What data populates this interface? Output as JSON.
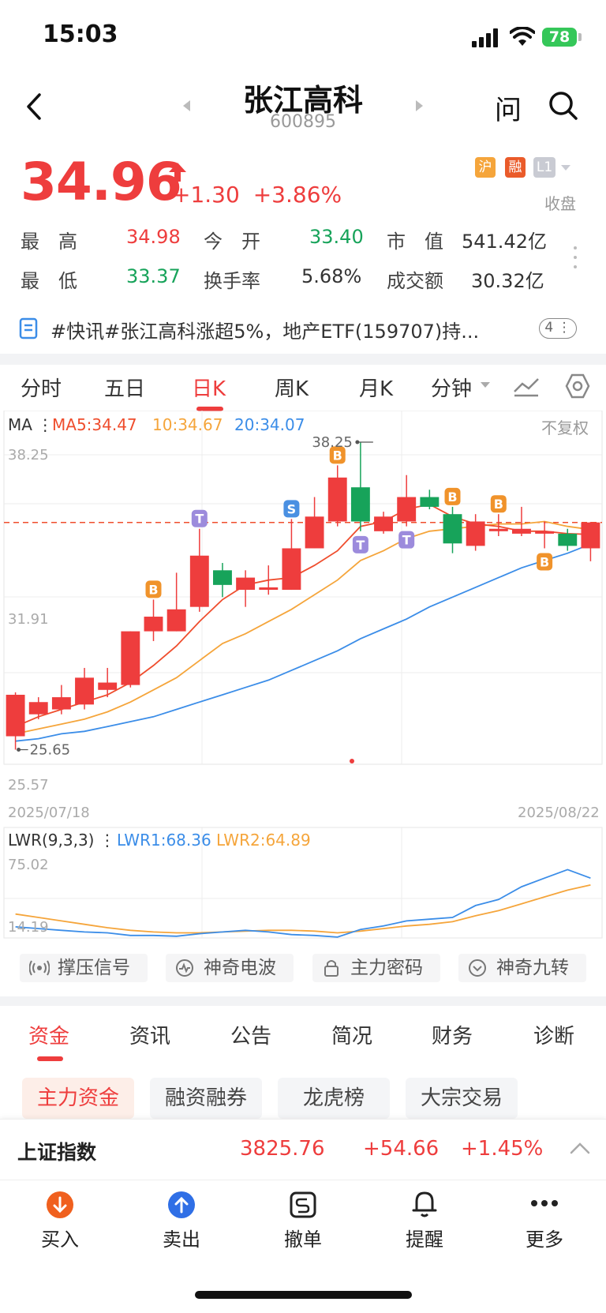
{
  "status_bar": {
    "time": "15:03",
    "battery": "78"
  },
  "header": {
    "name": "张江高科",
    "code": "600895",
    "ask_label": "问"
  },
  "quote": {
    "price": "34.96",
    "change": "+1.30",
    "change_pct": "+3.86%",
    "badges": [
      "沪",
      "融",
      "L1"
    ],
    "market_status": "收盘",
    "stats": [
      {
        "label": "最　高",
        "value": "34.98",
        "color": "red"
      },
      {
        "label": "今　开",
        "value": "33.40",
        "color": "green"
      },
      {
        "label": "市　值",
        "value": "541.42亿",
        "color": "dark"
      },
      {
        "label": "最　低",
        "value": "33.37",
        "color": "green"
      },
      {
        "label": "换手率",
        "value": "5.68%",
        "color": "dark"
      },
      {
        "label": "成交额",
        "value": "30.32亿",
        "color": "dark"
      }
    ]
  },
  "news": {
    "text": "#快讯#张江高科涨超5%，地产ETF(159707)持...",
    "count": "4"
  },
  "chart_tabs": [
    "分时",
    "五日",
    "日K",
    "周K",
    "月K",
    "分钟"
  ],
  "chart_tab_active": "日K",
  "ma_legend": {
    "title": "MA",
    "ma5": "MA5:34.47",
    "ma10": "10:34.67",
    "ma20": "20:34.07",
    "adjust": "不复权"
  },
  "colors": {
    "up": "#ee3d3d",
    "down": "#17a35a",
    "ma5": "#ef4d2d",
    "ma10": "#f5a53b",
    "ma20": "#3b8de8"
  },
  "chart_data": {
    "type": "candlestick",
    "y_axis_labels": [
      "38.25",
      "31.91",
      "25.57"
    ],
    "ylim": [
      25.57,
      38.25
    ],
    "x_start": "2025/07/18",
    "x_end": "2025/08/22",
    "high_marker": "38.25",
    "low_marker": "25.65",
    "current_price_line": 34.96,
    "candles": [
      {
        "o": 26.2,
        "c": 27.9,
        "h": 28.0,
        "l": 25.65
      },
      {
        "o": 27.1,
        "c": 27.6,
        "h": 27.8,
        "l": 26.9
      },
      {
        "o": 27.3,
        "c": 27.8,
        "h": 28.3,
        "l": 27.1
      },
      {
        "o": 27.5,
        "c": 28.6,
        "h": 29.0,
        "l": 27.3
      },
      {
        "o": 28.1,
        "c": 28.4,
        "h": 29.0,
        "l": 27.8
      },
      {
        "o": 28.3,
        "c": 30.5,
        "h": 30.5,
        "l": 28.2
      },
      {
        "o": 30.5,
        "c": 31.1,
        "h": 31.8,
        "l": 30.1
      },
      {
        "o": 30.5,
        "c": 31.4,
        "h": 32.9,
        "l": 30.5
      },
      {
        "o": 31.5,
        "c": 33.6,
        "h": 34.7,
        "l": 31.3
      },
      {
        "o": 33.0,
        "c": 32.4,
        "h": 33.3,
        "l": 31.9
      },
      {
        "o": 32.2,
        "c": 32.7,
        "h": 33.0,
        "l": 31.5
      },
      {
        "o": 32.2,
        "c": 32.3,
        "h": 33.2,
        "l": 32.0
      },
      {
        "o": 32.2,
        "c": 33.9,
        "h": 35.1,
        "l": 32.2
      },
      {
        "o": 33.9,
        "c": 35.2,
        "h": 36.0,
        "l": 33.9
      },
      {
        "o": 35.0,
        "c": 36.8,
        "h": 37.3,
        "l": 34.8
      },
      {
        "o": 36.4,
        "c": 35.0,
        "h": 38.25,
        "l": 34.6
      },
      {
        "o": 34.6,
        "c": 35.2,
        "h": 35.4,
        "l": 34.5
      },
      {
        "o": 35.0,
        "c": 36.0,
        "h": 36.9,
        "l": 34.8
      },
      {
        "o": 36.0,
        "c": 35.6,
        "h": 36.3,
        "l": 35.5
      },
      {
        "o": 35.3,
        "c": 34.1,
        "h": 35.6,
        "l": 33.7
      },
      {
        "o": 34.0,
        "c": 35.0,
        "h": 35.3,
        "l": 33.8
      },
      {
        "o": 34.6,
        "c": 34.7,
        "h": 35.3,
        "l": 34.4
      },
      {
        "o": 34.5,
        "c": 34.7,
        "h": 35.6,
        "l": 34.4
      },
      {
        "o": 34.5,
        "c": 34.6,
        "h": 35.0,
        "l": 33.9
      },
      {
        "o": 34.5,
        "c": 34.0,
        "h": 34.7,
        "l": 33.8
      },
      {
        "o": 33.9,
        "c": 34.96,
        "h": 34.98,
        "l": 33.37
      }
    ],
    "ma5": [
      26.6,
      27.0,
      27.3,
      27.6,
      27.9,
      28.4,
      29.1,
      29.9,
      30.9,
      31.8,
      32.4,
      32.6,
      32.7,
      33.2,
      33.8,
      34.8,
      35.0,
      35.5,
      35.7,
      35.2,
      34.9,
      34.8,
      34.6,
      34.6,
      34.5,
      34.47
    ],
    "ma10": [
      26.3,
      26.5,
      26.7,
      26.9,
      27.2,
      27.6,
      28.1,
      28.6,
      29.3,
      30.0,
      30.4,
      30.9,
      31.4,
      32.0,
      32.6,
      33.4,
      33.8,
      34.3,
      34.6,
      34.7,
      34.8,
      34.9,
      34.9,
      35.0,
      34.8,
      34.67
    ],
    "ma20": [
      26.0,
      26.1,
      26.3,
      26.4,
      26.6,
      26.8,
      27.0,
      27.3,
      27.6,
      27.9,
      28.2,
      28.5,
      28.9,
      29.3,
      29.7,
      30.2,
      30.6,
      31.0,
      31.5,
      31.9,
      32.3,
      32.7,
      33.1,
      33.4,
      33.7,
      34.07
    ],
    "markers": [
      {
        "i": 6,
        "type": "B",
        "pos": "above"
      },
      {
        "i": 8,
        "type": "T",
        "pos": "above"
      },
      {
        "i": 12,
        "type": "S",
        "pos": "above"
      },
      {
        "i": 14,
        "type": "B",
        "pos": "above"
      },
      {
        "i": 15,
        "type": "T",
        "pos": "below"
      },
      {
        "i": 17,
        "type": "T",
        "pos": "below"
      },
      {
        "i": 19,
        "type": "B",
        "pos": "above"
      },
      {
        "i": 21,
        "type": "B",
        "pos": "above"
      },
      {
        "i": 23,
        "type": "B",
        "pos": "below"
      }
    ]
  },
  "lwr": {
    "title": "LWR(9,3,3)",
    "lwr1_label": "LWR1:68.36",
    "lwr2_label": "LWR2:64.89",
    "axis_labels": [
      "75.02",
      "14.19"
    ],
    "ylim": [
      0,
      85
    ],
    "lwr1": [
      13,
      11,
      9,
      7,
      6,
      3,
      3,
      2,
      5,
      7,
      9,
      7,
      4,
      3,
      1,
      10,
      14,
      20,
      22,
      24,
      38,
      45,
      60,
      70,
      80,
      70
    ],
    "lwr2": [
      28,
      24,
      20,
      16,
      12,
      9,
      7,
      6,
      6,
      7,
      8,
      9,
      9,
      8,
      6,
      8,
      11,
      14,
      16,
      19,
      26,
      32,
      40,
      48,
      56,
      62
    ]
  },
  "signal_buttons": [
    "撑压信号",
    "神奇电波",
    "主力密码",
    "神奇九转"
  ],
  "section_tabs": [
    "资金",
    "资讯",
    "公告",
    "简况",
    "财务",
    "诊断"
  ],
  "section_tab_active": "资金",
  "sub_tabs": [
    "主力资金",
    "融资融券",
    "龙虎榜",
    "大宗交易"
  ],
  "index_bar": {
    "name": "上证指数",
    "value": "3825.76",
    "change": "+54.66",
    "change_pct": "+1.45%"
  },
  "toolbar": [
    "买入",
    "卖出",
    "撤单",
    "提醒",
    "更多"
  ]
}
